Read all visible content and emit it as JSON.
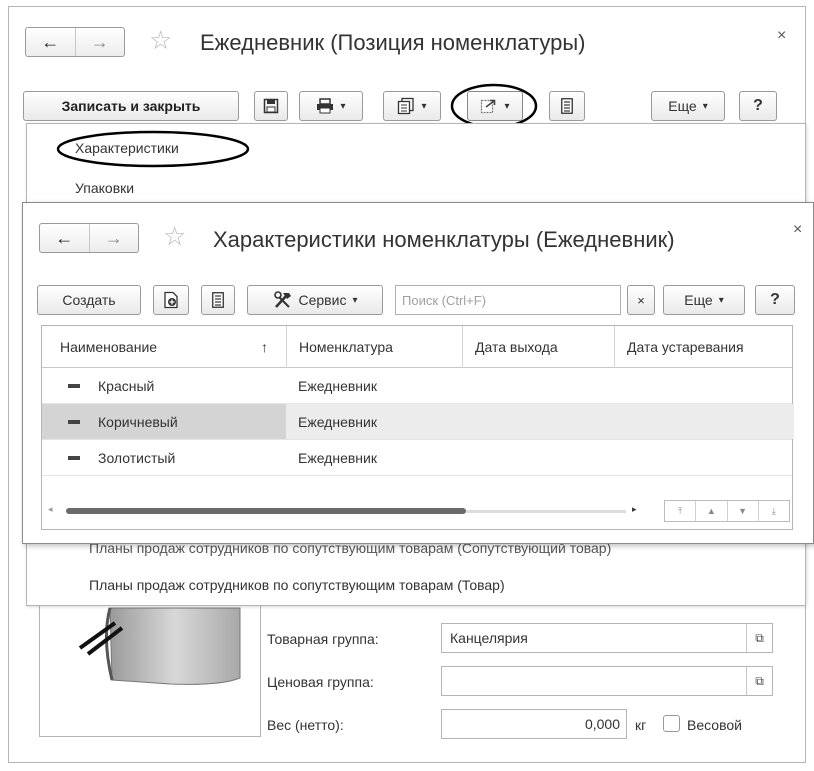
{
  "main": {
    "title": "Ежедневник (Позиция номенклатуры)",
    "close": "×",
    "toolbar": {
      "save_close": "Записать и закрыть",
      "more": "Еще",
      "help": "?"
    }
  },
  "dropdown": {
    "items": [
      "Характеристики",
      "Упаковки",
      "Планы продаж сотрудников по сопутствующим товарам (Сопутствующий товар)",
      "Планы продаж сотрудников по сопутствующим товарам (Товар)"
    ]
  },
  "overlay": {
    "title": "Характеристики номенклатуры (Ежедневник)",
    "close": "×",
    "toolbar": {
      "create": "Создать",
      "service": "Сервис",
      "search_placeholder": "Поиск (Ctrl+F)",
      "clear": "×",
      "more": "Еще",
      "help": "?"
    },
    "table": {
      "columns": [
        "Наименование",
        "Номенклатура",
        "Дата выхода",
        "Дата устаревания"
      ],
      "sort_indicator": "↑",
      "rows": [
        {
          "name": "Красный",
          "nomenclature": "Ежедневник",
          "release_date": "",
          "obsolete_date": "",
          "selected": false
        },
        {
          "name": "Коричневый",
          "nomenclature": "Ежедневник",
          "release_date": "",
          "obsolete_date": "",
          "selected": true
        },
        {
          "name": "Золотистый",
          "nomenclature": "Ежедневник",
          "release_date": "",
          "obsolete_date": "",
          "selected": false
        }
      ]
    }
  },
  "form": {
    "product_group_label": "Товарная группа:",
    "product_group_value": "Канцелярия",
    "price_group_label": "Ценовая группа:",
    "price_group_value": "",
    "weight_label": "Вес (нетто):",
    "weight_value": "0,000",
    "weight_unit": "кг",
    "weighted_label": "Весовой"
  },
  "icons": [
    "back-arrow-icon",
    "forward-arrow-icon",
    "star-icon",
    "save-icon",
    "print-icon",
    "copy-document-icon",
    "go-to-icon",
    "list-icon",
    "new-document-icon",
    "tools-icon",
    "open-link-icon"
  ],
  "colors": {
    "selected_row": "#d4d4d4",
    "highlight_ellipse": "#000000"
  }
}
